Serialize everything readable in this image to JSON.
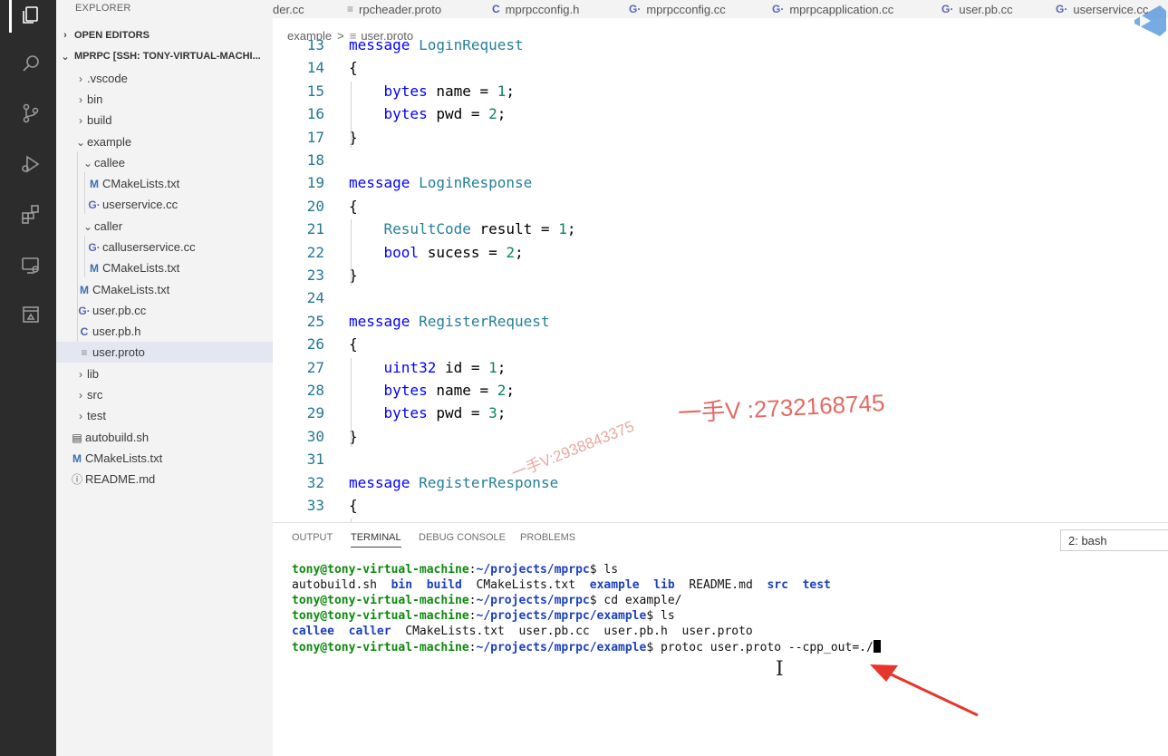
{
  "sidebar": {
    "title": "EXPLORER",
    "open_editors": "OPEN EDITORS",
    "project": "MPRPC [SSH: TONY-VIRTUAL-MACHI...",
    "items": [
      {
        "label": ".vscode",
        "kind": "folder-closed"
      },
      {
        "label": "bin",
        "kind": "folder-closed"
      },
      {
        "label": "build",
        "kind": "folder-closed"
      },
      {
        "label": "example",
        "kind": "folder-open"
      },
      {
        "label": "callee",
        "kind": "folder-open"
      },
      {
        "label": "CMakeLists.txt",
        "kind": "cmake"
      },
      {
        "label": "userservice.cc",
        "kind": "cpp"
      },
      {
        "label": "caller",
        "kind": "folder-open"
      },
      {
        "label": "calluserservice.cc",
        "kind": "cpp"
      },
      {
        "label": "CMakeLists.txt",
        "kind": "cmake"
      },
      {
        "label": "CMakeLists.txt",
        "kind": "cmake"
      },
      {
        "label": "user.pb.cc",
        "kind": "cpp"
      },
      {
        "label": "user.pb.h",
        "kind": "c-header"
      },
      {
        "label": "user.proto",
        "kind": "proto"
      },
      {
        "label": "lib",
        "kind": "folder-closed"
      },
      {
        "label": "src",
        "kind": "folder-closed"
      },
      {
        "label": "test",
        "kind": "folder-closed"
      },
      {
        "label": "autobuild.sh",
        "kind": "shell"
      },
      {
        "label": "CMakeLists.txt",
        "kind": "cmake"
      },
      {
        "label": "README.md",
        "kind": "info"
      }
    ]
  },
  "tabs": [
    {
      "label": "der.cc",
      "icon": ""
    },
    {
      "label": "rpcheader.proto",
      "icon": "≡"
    },
    {
      "label": "mprpcconfig.h",
      "icon": "C"
    },
    {
      "label": "mprpcconfig.cc",
      "icon": "G·"
    },
    {
      "label": "mprpcapplication.cc",
      "icon": "G·"
    },
    {
      "label": "user.pb.cc",
      "icon": "G·"
    },
    {
      "label": "userservice.cc",
      "icon": "G·"
    }
  ],
  "breadcrumb": {
    "folder": "example",
    "sep": ">",
    "file": "user.proto",
    "file_icon": "≡"
  },
  "editor": {
    "lines": [
      {
        "n": "13",
        "html": "<span class=\"kw\">message</span> <span class=\"ty\">LoginRequest</span>"
      },
      {
        "n": "14",
        "html": "{"
      },
      {
        "n": "15",
        "html": "    <span class=\"kw\">bytes</span> name = <span class=\"nm\">1</span>;"
      },
      {
        "n": "16",
        "html": "    <span class=\"kw\">bytes</span> pwd = <span class=\"nm\">2</span>;"
      },
      {
        "n": "17",
        "html": "}"
      },
      {
        "n": "18",
        "html": ""
      },
      {
        "n": "19",
        "html": "<span class=\"kw\">message</span> <span class=\"ty\">LoginResponse</span>"
      },
      {
        "n": "20",
        "html": "{"
      },
      {
        "n": "21",
        "html": "    <span class=\"ty\">ResultCode</span> result = <span class=\"nm\">1</span>;"
      },
      {
        "n": "22",
        "html": "    <span class=\"kw\">bool</span> sucess = <span class=\"nm\">2</span>;"
      },
      {
        "n": "23",
        "html": "}"
      },
      {
        "n": "24",
        "html": ""
      },
      {
        "n": "25",
        "html": "<span class=\"kw\">message</span> <span class=\"ty\">RegisterRequest</span>"
      },
      {
        "n": "26",
        "html": "{"
      },
      {
        "n": "27",
        "html": "    <span class=\"kw\">uint32</span> id = <span class=\"nm\">1</span>;"
      },
      {
        "n": "28",
        "html": "    <span class=\"kw\">bytes</span> name = <span class=\"nm\">2</span>;"
      },
      {
        "n": "29",
        "html": "    <span class=\"kw\">bytes</span> pwd = <span class=\"nm\">3</span>;"
      },
      {
        "n": "30",
        "html": "}"
      },
      {
        "n": "31",
        "html": ""
      },
      {
        "n": "32",
        "html": "<span class=\"kw\">message</span> <span class=\"ty\">RegisterResponse</span>"
      },
      {
        "n": "33",
        "html": "{"
      }
    ]
  },
  "panel": {
    "tabs": [
      "OUTPUT",
      "TERMINAL",
      "DEBUG CONSOLE",
      "PROBLEMS"
    ],
    "active_tab": "TERMINAL",
    "terminal_select": "2: bash",
    "terminal_lines": [
      "<span class=\"pg\">tony@tony-virtual-machine</span>:<span class=\"pb\">~/projects/mprpc</span>$ ls",
      "autobuild.sh  <span class=\"dir\">bin</span>  <span class=\"dir\">build</span>  CMakeLists.txt  <span class=\"dir\">example</span>  <span class=\"dir\">lib</span>  README.md  <span class=\"dir\">src</span>  <span class=\"dir\">test</span>",
      "<span class=\"pg\">tony@tony-virtual-machine</span>:<span class=\"pb\">~/projects/mprpc</span>$ cd example/",
      "<span class=\"pg\">tony@tony-virtual-machine</span>:<span class=\"pb\">~/projects/mprpc/example</span>$ ls",
      "<span class=\"dir\">callee</span>  <span class=\"dir\">caller</span>  CMakeLists.txt  user.pb.cc  user.pb.h  user.proto",
      "<span class=\"pg\">tony@tony-virtual-machine</span>:<span class=\"pb\">~/projects/mprpc/example</span>$ protoc user.proto --cpp_out=./<span id=\"cursor\"></span>"
    ]
  },
  "watermarks": {
    "primary": "一手V :2732168745",
    "secondary": "一手V:2938843375"
  },
  "colors": {
    "accent": "#0000ff",
    "prompt_user": "#0c8a0c",
    "prompt_path": "#1c3fc0",
    "arrow": "#e8352b"
  }
}
